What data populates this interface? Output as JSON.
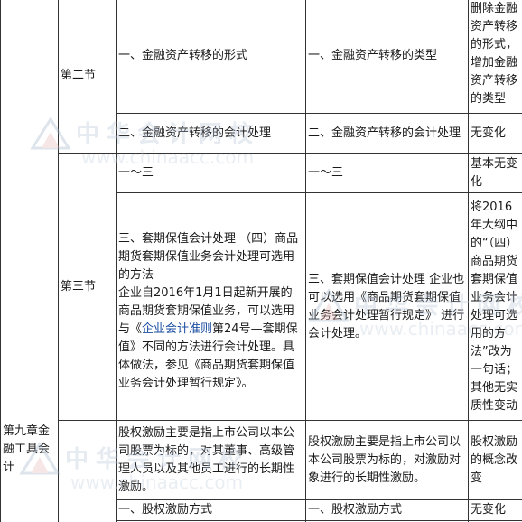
{
  "chapter": "第九章金融工具会计",
  "watermark": {
    "cn": "中华会计网校",
    "url": "www.chinaacc.com"
  },
  "section2": {
    "label": "第二节",
    "rows": [
      {
        "old": "一、金融资产转移的形式",
        "new": "一、金融资产转移的类型",
        "change": "删除金融资产转移的形式，增加金融资产转移的类型"
      },
      {
        "old": "二、金融资产转移的会计处理",
        "new": "二、金融资产转移的会计处理",
        "change": "无变化"
      }
    ]
  },
  "section3": {
    "label": "第三节",
    "rows": [
      {
        "old": "一～三",
        "new": "一～三",
        "change": "基本无变化"
      },
      {
        "old_a": "三、套期保值会计处理 （四）商品期货套期保值业务会计处理可选用的方法",
        "old_b": "企业自2016年1月1日起新开展的商品期货套期保值业务，可以选用与《",
        "old_link": "企业会计准则",
        "old_c": "第24号—套期保值》不同的方法进行会计处理。具体做法，参见《商品期货套期保值业务会计处理暂行规定》。",
        "new": "三、套期保值会计处理 企业也可以选用《商品期货套期保值业务会计处理暂行规定》 进行会计处理。",
        "change": "将2016年大纲中的“（四）商品期货套期保值业务会计处理可选用的方法”改为一句话；其他无实质性变动"
      }
    ]
  },
  "section4": {
    "rows": [
      {
        "old": "股权激励主要是指上市公司以本公司股票为标的，对其董事、高级管理人员以及其他员工进行的长期性激励。",
        "new": "股权激励主要是指上市公司以本公司股票为标的，对激励对象进行的长期性激励。",
        "change": "股权激励的概念改变"
      },
      {
        "old": "一、股权激励方式",
        "new": "一、股权激励方式",
        "change": "无变化"
      }
    ]
  }
}
